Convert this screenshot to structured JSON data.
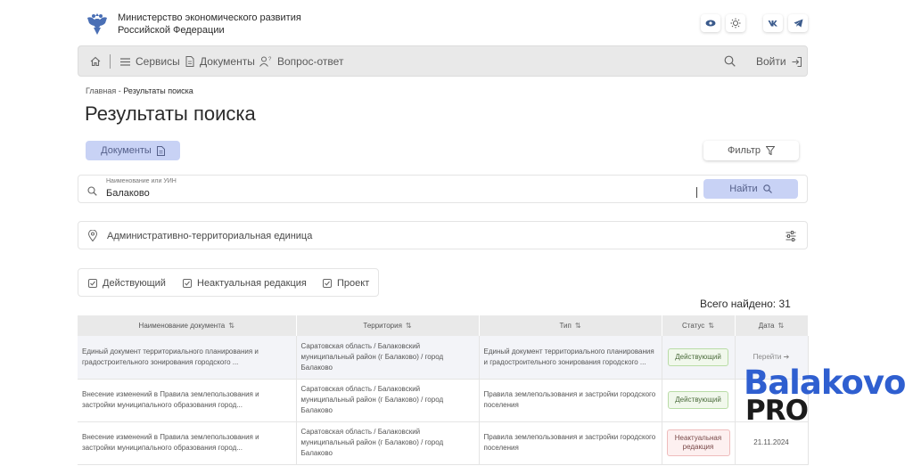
{
  "header": {
    "ministry_line1": "Министерство экономического развития",
    "ministry_line2": "Российской Федерации",
    "actions": [
      "eye-icon",
      "sun-icon",
      "vk-icon",
      "telegram-icon"
    ]
  },
  "nav": {
    "services": "Сервисы",
    "documents": "Документы",
    "qa": "Вопрос-ответ",
    "login": "Войти"
  },
  "breadcrumb": {
    "home": "Главная",
    "separator": "-",
    "current": "Результаты поиска"
  },
  "page_title": "Результаты поиска",
  "tabs": {
    "documents": "Документы",
    "filter": "Фильтр"
  },
  "search": {
    "label": "Наименование или УИН",
    "value": "Балаково",
    "button": "Найти"
  },
  "ate": {
    "placeholder": "Административно-территориальная единица"
  },
  "statuses": [
    {
      "label": "Действующий",
      "checked": true
    },
    {
      "label": "Неактуальная редакция",
      "checked": true
    },
    {
      "label": "Проект",
      "checked": true
    }
  ],
  "total": {
    "label": "Всего найдено:",
    "count": "31"
  },
  "table": {
    "headers": [
      "Наименование документа",
      "Территория",
      "Тип",
      "Статус",
      "Дата"
    ],
    "rows": [
      {
        "name": "Единый документ территориального планирования и градостроительного зонирования городского ...",
        "territory": "Саратовская область / Балаковский муниципальный район (г Балаково) / город Балаково",
        "type": "Единый документ территориального планирования и градостроительного зонирования городского ...",
        "status": "Действующий",
        "date": "Перейти"
      },
      {
        "name": "Внесение изменений в Правила землепользования и застройки муниципального образования город...",
        "territory": "Саратовская область / Балаковский муниципальный район (г Балаково) / город Балаково",
        "type": "Правила землепользования и застройки городского поселения",
        "status": "Действующий",
        "date": ""
      },
      {
        "name": "Внесение изменений в Правила землепользования и застройки муниципального образования город...",
        "territory": "Саратовская область / Балаковский муниципальный район (г Балаково) / город Балаково",
        "type": "Правила землепользования и застройки городского поселения",
        "status": "Неактуальная редакция",
        "date": "21.11.2024"
      }
    ]
  },
  "watermark": {
    "line1": "Balakovo",
    "line2": "PRO"
  },
  "colors": {
    "accent_button": "#c8d2f5",
    "nav_bg": "#e9e9e9",
    "status_active": "#b9dca6",
    "status_outdated": "#efbcbc",
    "watermark_blue": "#2f5fd0"
  }
}
